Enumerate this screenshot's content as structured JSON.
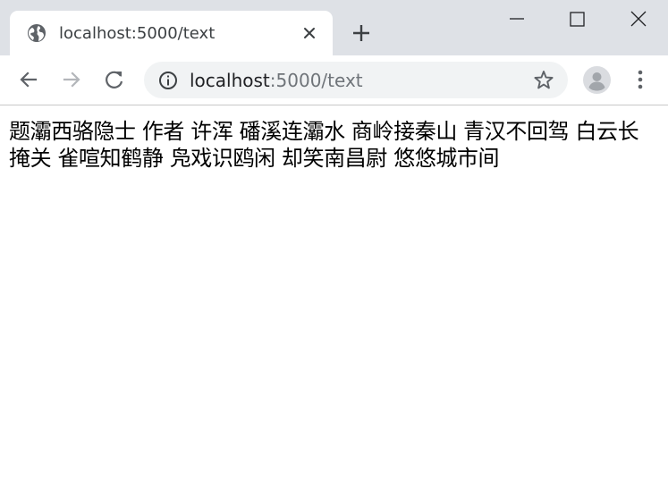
{
  "browser": {
    "tab": {
      "title": "localhost:5000/text",
      "favicon": "globe-icon"
    },
    "address_bar": {
      "host": "localhost",
      "path": ":5000/text",
      "info_icon": "info-icon"
    },
    "icons": {
      "close_tab": "close-icon",
      "new_tab": "plus-icon",
      "back": "arrow-left-icon",
      "forward": "arrow-right-icon",
      "reload": "reload-icon",
      "bookmark": "star-icon",
      "profile": "avatar-icon",
      "menu": "kebab-menu-icon",
      "minimize": "minimize-icon",
      "maximize": "maximize-icon",
      "close_window": "close-icon"
    },
    "colors": {
      "tabstrip": "#dee1e6",
      "omnibox": "#f1f3f4",
      "url_path": "#6f7479"
    }
  },
  "page": {
    "text": "题灞西骆隐士 作者 许浑 磻溪连灞水 商岭接秦山 青汉不回驾 白云长掩关 雀喧知鹤静 凫戏识鸥闲 却笑南昌尉 悠悠城市间"
  }
}
